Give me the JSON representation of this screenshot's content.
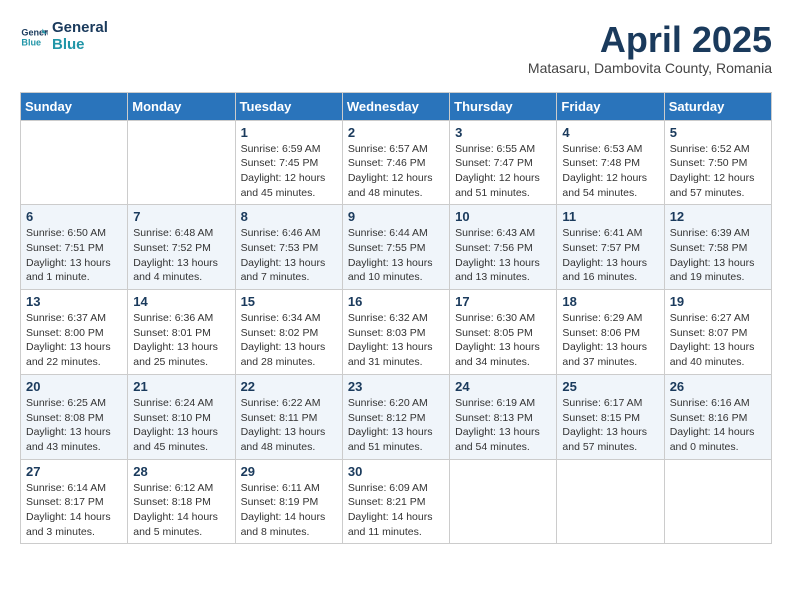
{
  "header": {
    "logo_line1": "General",
    "logo_line2": "Blue",
    "calendar_title": "April 2025",
    "calendar_subtitle": "Matasaru, Dambovita County, Romania"
  },
  "weekdays": [
    "Sunday",
    "Monday",
    "Tuesday",
    "Wednesday",
    "Thursday",
    "Friday",
    "Saturday"
  ],
  "weeks": [
    [
      {
        "day": null
      },
      {
        "day": null
      },
      {
        "day": "1",
        "sunrise": "Sunrise: 6:59 AM",
        "sunset": "Sunset: 7:45 PM",
        "daylight": "Daylight: 12 hours and 45 minutes."
      },
      {
        "day": "2",
        "sunrise": "Sunrise: 6:57 AM",
        "sunset": "Sunset: 7:46 PM",
        "daylight": "Daylight: 12 hours and 48 minutes."
      },
      {
        "day": "3",
        "sunrise": "Sunrise: 6:55 AM",
        "sunset": "Sunset: 7:47 PM",
        "daylight": "Daylight: 12 hours and 51 minutes."
      },
      {
        "day": "4",
        "sunrise": "Sunrise: 6:53 AM",
        "sunset": "Sunset: 7:48 PM",
        "daylight": "Daylight: 12 hours and 54 minutes."
      },
      {
        "day": "5",
        "sunrise": "Sunrise: 6:52 AM",
        "sunset": "Sunset: 7:50 PM",
        "daylight": "Daylight: 12 hours and 57 minutes."
      }
    ],
    [
      {
        "day": "6",
        "sunrise": "Sunrise: 6:50 AM",
        "sunset": "Sunset: 7:51 PM",
        "daylight": "Daylight: 13 hours and 1 minute."
      },
      {
        "day": "7",
        "sunrise": "Sunrise: 6:48 AM",
        "sunset": "Sunset: 7:52 PM",
        "daylight": "Daylight: 13 hours and 4 minutes."
      },
      {
        "day": "8",
        "sunrise": "Sunrise: 6:46 AM",
        "sunset": "Sunset: 7:53 PM",
        "daylight": "Daylight: 13 hours and 7 minutes."
      },
      {
        "day": "9",
        "sunrise": "Sunrise: 6:44 AM",
        "sunset": "Sunset: 7:55 PM",
        "daylight": "Daylight: 13 hours and 10 minutes."
      },
      {
        "day": "10",
        "sunrise": "Sunrise: 6:43 AM",
        "sunset": "Sunset: 7:56 PM",
        "daylight": "Daylight: 13 hours and 13 minutes."
      },
      {
        "day": "11",
        "sunrise": "Sunrise: 6:41 AM",
        "sunset": "Sunset: 7:57 PM",
        "daylight": "Daylight: 13 hours and 16 minutes."
      },
      {
        "day": "12",
        "sunrise": "Sunrise: 6:39 AM",
        "sunset": "Sunset: 7:58 PM",
        "daylight": "Daylight: 13 hours and 19 minutes."
      }
    ],
    [
      {
        "day": "13",
        "sunrise": "Sunrise: 6:37 AM",
        "sunset": "Sunset: 8:00 PM",
        "daylight": "Daylight: 13 hours and 22 minutes."
      },
      {
        "day": "14",
        "sunrise": "Sunrise: 6:36 AM",
        "sunset": "Sunset: 8:01 PM",
        "daylight": "Daylight: 13 hours and 25 minutes."
      },
      {
        "day": "15",
        "sunrise": "Sunrise: 6:34 AM",
        "sunset": "Sunset: 8:02 PM",
        "daylight": "Daylight: 13 hours and 28 minutes."
      },
      {
        "day": "16",
        "sunrise": "Sunrise: 6:32 AM",
        "sunset": "Sunset: 8:03 PM",
        "daylight": "Daylight: 13 hours and 31 minutes."
      },
      {
        "day": "17",
        "sunrise": "Sunrise: 6:30 AM",
        "sunset": "Sunset: 8:05 PM",
        "daylight": "Daylight: 13 hours and 34 minutes."
      },
      {
        "day": "18",
        "sunrise": "Sunrise: 6:29 AM",
        "sunset": "Sunset: 8:06 PM",
        "daylight": "Daylight: 13 hours and 37 minutes."
      },
      {
        "day": "19",
        "sunrise": "Sunrise: 6:27 AM",
        "sunset": "Sunset: 8:07 PM",
        "daylight": "Daylight: 13 hours and 40 minutes."
      }
    ],
    [
      {
        "day": "20",
        "sunrise": "Sunrise: 6:25 AM",
        "sunset": "Sunset: 8:08 PM",
        "daylight": "Daylight: 13 hours and 43 minutes."
      },
      {
        "day": "21",
        "sunrise": "Sunrise: 6:24 AM",
        "sunset": "Sunset: 8:10 PM",
        "daylight": "Daylight: 13 hours and 45 minutes."
      },
      {
        "day": "22",
        "sunrise": "Sunrise: 6:22 AM",
        "sunset": "Sunset: 8:11 PM",
        "daylight": "Daylight: 13 hours and 48 minutes."
      },
      {
        "day": "23",
        "sunrise": "Sunrise: 6:20 AM",
        "sunset": "Sunset: 8:12 PM",
        "daylight": "Daylight: 13 hours and 51 minutes."
      },
      {
        "day": "24",
        "sunrise": "Sunrise: 6:19 AM",
        "sunset": "Sunset: 8:13 PM",
        "daylight": "Daylight: 13 hours and 54 minutes."
      },
      {
        "day": "25",
        "sunrise": "Sunrise: 6:17 AM",
        "sunset": "Sunset: 8:15 PM",
        "daylight": "Daylight: 13 hours and 57 minutes."
      },
      {
        "day": "26",
        "sunrise": "Sunrise: 6:16 AM",
        "sunset": "Sunset: 8:16 PM",
        "daylight": "Daylight: 14 hours and 0 minutes."
      }
    ],
    [
      {
        "day": "27",
        "sunrise": "Sunrise: 6:14 AM",
        "sunset": "Sunset: 8:17 PM",
        "daylight": "Daylight: 14 hours and 3 minutes."
      },
      {
        "day": "28",
        "sunrise": "Sunrise: 6:12 AM",
        "sunset": "Sunset: 8:18 PM",
        "daylight": "Daylight: 14 hours and 5 minutes."
      },
      {
        "day": "29",
        "sunrise": "Sunrise: 6:11 AM",
        "sunset": "Sunset: 8:19 PM",
        "daylight": "Daylight: 14 hours and 8 minutes."
      },
      {
        "day": "30",
        "sunrise": "Sunrise: 6:09 AM",
        "sunset": "Sunset: 8:21 PM",
        "daylight": "Daylight: 14 hours and 11 minutes."
      },
      {
        "day": null
      },
      {
        "day": null
      },
      {
        "day": null
      }
    ]
  ]
}
